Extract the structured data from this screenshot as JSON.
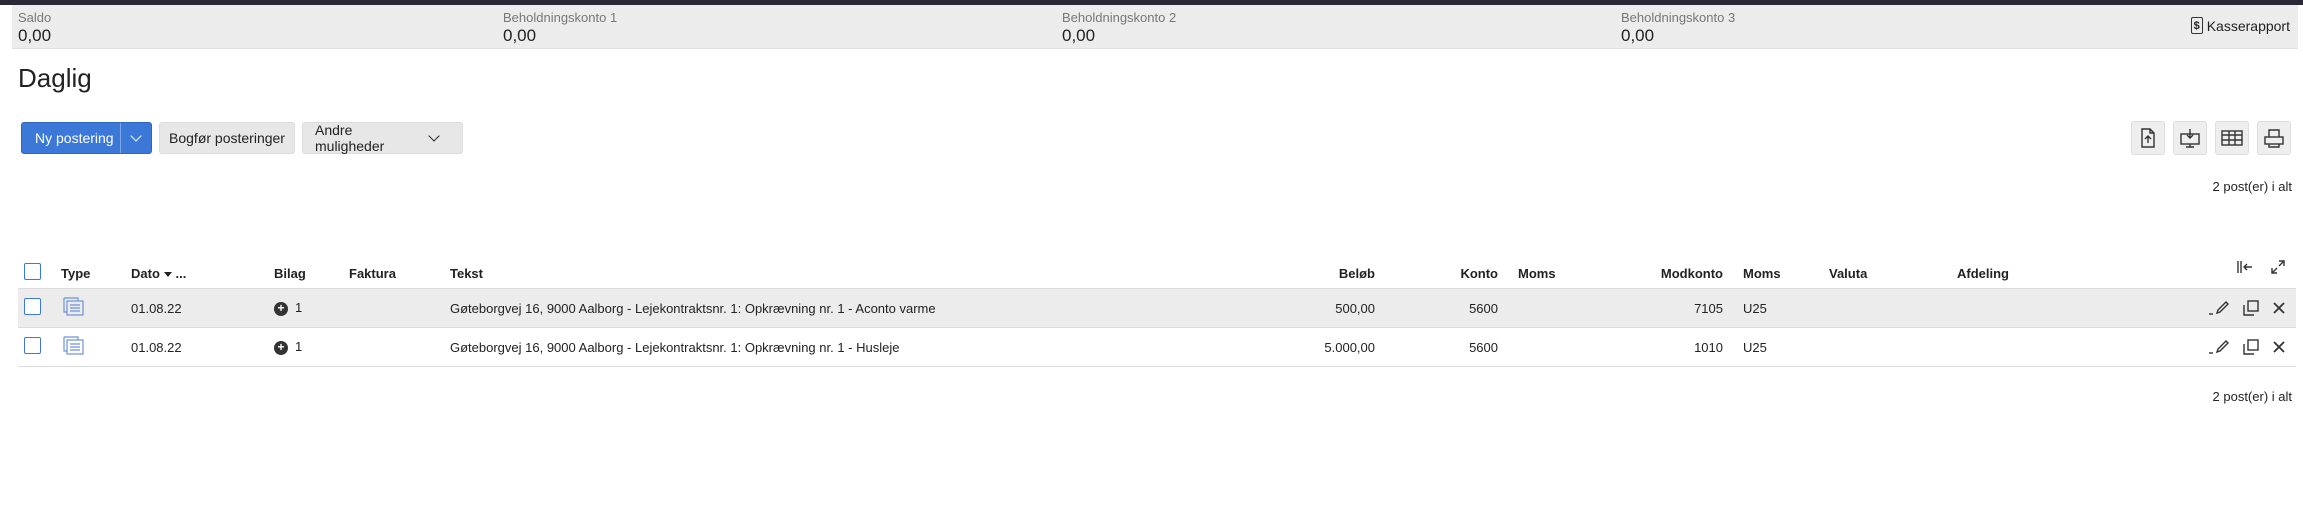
{
  "summary": {
    "items": [
      {
        "label": "Saldo",
        "value": "0,00"
      },
      {
        "label": "Beholdningskonto 1",
        "value": "0,00"
      },
      {
        "label": "Beholdningskonto 2",
        "value": "0,00"
      },
      {
        "label": "Beholdningskonto 3",
        "value": "0,00"
      }
    ],
    "report_button": "Kasserapport",
    "report_icon": "$"
  },
  "page": {
    "title": "Daglig"
  },
  "toolbar": {
    "new_posting": "Ny postering",
    "post_entries": "Bogfør posteringer",
    "other_options": "Andre muligheder",
    "tools": [
      "export-file-icon",
      "import-monitor-icon",
      "table-columns-icon",
      "print-icon"
    ]
  },
  "count_top": "2 post(er) i alt",
  "count_bottom": "2 post(er) i alt",
  "table": {
    "headers": {
      "type": "Type",
      "date": "Dato",
      "date_more": "...",
      "bilag": "Bilag",
      "faktura": "Faktura",
      "tekst": "Tekst",
      "belob": "Beløb",
      "konto": "Konto",
      "moms": "Moms",
      "modkonto": "Modkonto",
      "moms2": "Moms",
      "valuta": "Valuta",
      "afdeling": "Afdeling"
    },
    "rows": [
      {
        "date": "01.08.22",
        "bilag": "1",
        "tekst": "Gøteborgvej 16, 9000 Aalborg - Lejekontraktsnr. 1: Opkrævning nr. 1 - Aconto varme",
        "belob": "500,00",
        "konto": "5600",
        "moms": "",
        "modkonto": "7105",
        "moms2": "U25",
        "valuta": "",
        "afdeling": ""
      },
      {
        "date": "01.08.22",
        "bilag": "1",
        "tekst": "Gøteborgvej 16, 9000 Aalborg - Lejekontraktsnr. 1: Opkrævning nr. 1 - Husleje",
        "belob": "5.000,00",
        "konto": "5600",
        "moms": "",
        "modkonto": "1010",
        "moms2": "U25",
        "valuta": "",
        "afdeling": ""
      }
    ]
  },
  "colors": {
    "primary": "#3c78d8",
    "summary_bg": "#ececec",
    "row_alt": "#ececec"
  }
}
